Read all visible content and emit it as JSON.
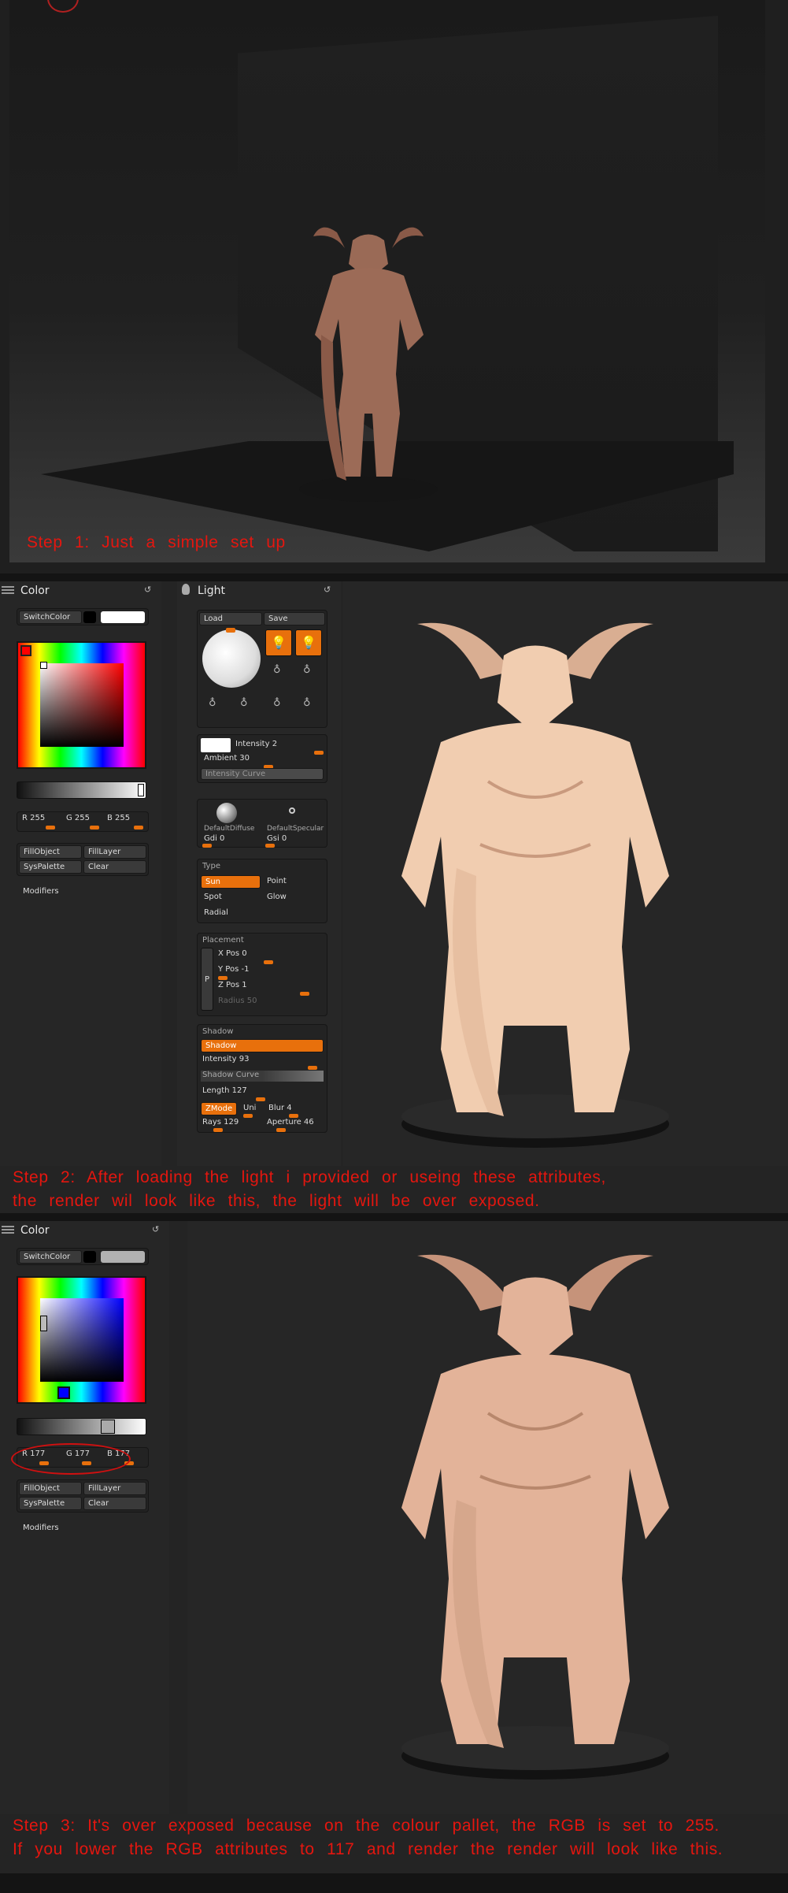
{
  "step1": {
    "caption": "Step 1: Just a simple set up"
  },
  "step2": {
    "caption_line1": "Step 2: After loading the light i provided or useing these attributes,",
    "caption_line2": "the render wil look like this, the light will be over exposed.",
    "color_panel": {
      "title": "Color",
      "switch_color": "SwitchColor",
      "r": "R 255",
      "g": "G 255",
      "b": "B 255",
      "fill_object": "FillObject",
      "fill_layer": "FillLayer",
      "sys_palette": "SysPalette",
      "clear": "Clear",
      "modifiers": "Modifiers",
      "main_color": "#ffffff",
      "square_hue": "#ff0000",
      "rgb": [
        255,
        255,
        255
      ]
    },
    "light_panel": {
      "title": "Light",
      "load": "Load",
      "save": "Save",
      "intensity": "Intensity 2",
      "ambient": "Ambient 30",
      "intensity_curve": "Intensity Curve",
      "default_diffuse": "DefaultDiffuse",
      "default_specular": "DefaultSpecular",
      "gdi": "Gdi 0",
      "gsi": "Gsi 0",
      "type_label": "Type",
      "sun": "Sun",
      "point": "Point",
      "spot": "Spot",
      "glow": "Glow",
      "radial": "Radial",
      "placement_label": "Placement",
      "p": "P",
      "x_pos": "X Pos 0",
      "y_pos": "Y Pos -1",
      "z_pos": "Z Pos 1",
      "radius": "Radius 50",
      "shadow_label": "Shadow",
      "shadow": "Shadow",
      "shadow_intensity": "Intensity 93",
      "shadow_curve": "Shadow Curve",
      "length": "Length 127",
      "zmode": "ZMode",
      "uni": "Uni",
      "blur": "Blur 4",
      "rays": "Rays 129",
      "aperture": "Aperture 46"
    }
  },
  "step3": {
    "caption_line1": "Step 3: It's over exposed because on the colour pallet, the RGB is set to 255.",
    "caption_line2": "If you lower the RGB attributes to 117 and render the render will look like this.",
    "color_panel": {
      "title": "Color",
      "switch_color": "SwitchColor",
      "r": "R 177",
      "g": "G 177",
      "b": "B 177",
      "fill_object": "FillObject",
      "fill_layer": "FillLayer",
      "sys_palette": "SysPalette",
      "clear": "Clear",
      "modifiers": "Modifiers",
      "main_color": "#b1b1b1",
      "square_hue": "#0000ff",
      "rgb": [
        177,
        177,
        177
      ]
    }
  },
  "colors": {
    "caption_red": "#e5160f",
    "zbrush_orange": "#e8700c",
    "render_skin_hot": "#f1cdb0",
    "render_skin_normal": "#e3b399"
  }
}
